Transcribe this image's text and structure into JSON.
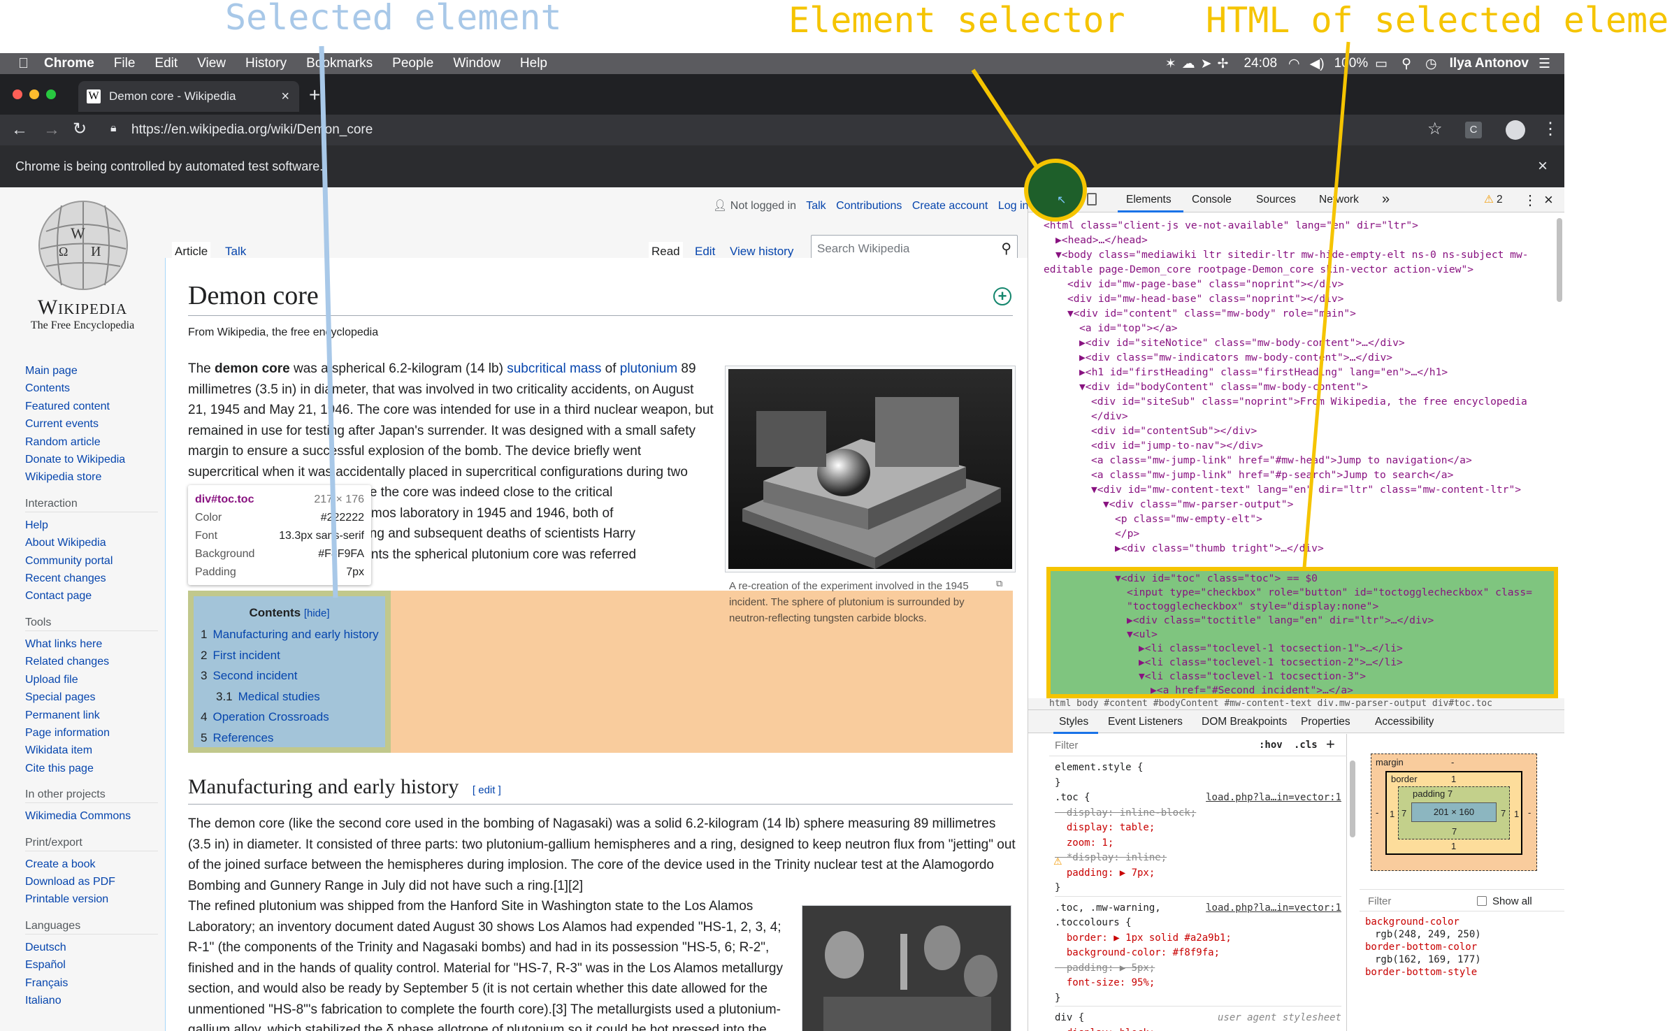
{
  "annotations": {
    "selected": "Selected element",
    "selector": "Element selector",
    "html": "HTML of selected element",
    "selected_color": "#a8c8e8",
    "selector_color": "#f5c400",
    "html_color": "#f5c400"
  },
  "menubar": {
    "app": "Chrome",
    "items": [
      "File",
      "Edit",
      "View",
      "History",
      "Bookmarks",
      "People",
      "Window",
      "Help"
    ],
    "time": "24:08",
    "battery": "100%",
    "user": "Ilya Antonov"
  },
  "tab": {
    "title": "Demon core - Wikipedia",
    "close": "×",
    "new": "+"
  },
  "toolbar": {
    "url": "https://en.wikipedia.org/wiki/Demon_core"
  },
  "infobar": {
    "text": "Chrome is being controlled by automated test software.",
    "close": "×"
  },
  "wiki": {
    "logo_title": "Wikipedia",
    "logo_sub": "The Free Encyclopedia",
    "personal": [
      "Not logged in",
      "Talk",
      "Contributions",
      "Create account",
      "Log in"
    ],
    "tabs_left": [
      "Article",
      "Talk"
    ],
    "tabs_right": [
      "Read",
      "Edit",
      "View history"
    ],
    "search_placeholder": "Search Wikipedia",
    "title": "Demon core",
    "from": "From Wikipedia, the free encyclopedia",
    "nav_main": [
      "Main page",
      "Contents",
      "Featured content",
      "Current events",
      "Random article",
      "Donate to Wikipedia",
      "Wikipedia store"
    ],
    "interaction_h": "Interaction",
    "interaction": [
      "Help",
      "About Wikipedia",
      "Community portal",
      "Recent changes",
      "Contact page"
    ],
    "tools_h": "Tools",
    "tools": [
      "What links here",
      "Related changes",
      "Upload file",
      "Special pages",
      "Permanent link",
      "Page information",
      "Wikidata item",
      "Cite this page"
    ],
    "projects_h": "In other projects",
    "projects": [
      "Wikimedia Commons"
    ],
    "print_h": "Print/export",
    "print": [
      "Create a book",
      "Download as PDF",
      "Printable version"
    ],
    "lang_h": "Languages",
    "langs": [
      "Deutsch",
      "Español",
      "Français",
      "Italiano"
    ],
    "para1": [
      [
        "The ",
        "demon core",
        " was a spherical 6.2-kilogram (14 lb) ",
        "subcritical mass",
        " of ",
        "plutonium",
        " 89"
      ],
      "millimetres (3.5 in) in diameter, that was involved in two criticality accidents, on August",
      "21, 1945 and May 21, 1946. The core was intended for use in a third nuclear weapon, but",
      "remained in use for testing after Japan's surrender. It was designed with a small safety",
      "margin to ensure a successful explosion of the bomb. The device briefly went",
      "supercritical when it was accidentally placed in supercritical configurations during two",
      "                    ended to guarantee the core was indeed close to the critical",
      "                    ined at the Los Alamos laboratory in 1945 and 1946, both of",
      "                    e radiation poisoning and subsequent deaths of scientists Harry",
      "                    . After these incidents the spherical plutonium core was referred"
    ],
    "figure_caption": "A re-creation of the experiment involved in the 1945 incident. The sphere of plutonium is surrounded by neutron-reflecting tungsten carbide blocks.",
    "tooltip": {
      "sel": "div#toc.toc",
      "size": "217 × 176",
      "rows": [
        [
          "Color",
          "#222222"
        ],
        [
          "Font",
          "13.3px sans-serif"
        ],
        [
          "Background",
          "#F8F9FA"
        ],
        [
          "Padding",
          "7px"
        ]
      ]
    },
    "toc": {
      "title": "Contents",
      "hide": "[hide]",
      "items": [
        [
          "1",
          "Manufacturing and early history"
        ],
        [
          "2",
          "First incident"
        ],
        [
          "3",
          "Second incident"
        ],
        [
          "3.1",
          "Medical studies"
        ],
        [
          "4",
          "Operation Crossroads"
        ],
        [
          "5",
          "References"
        ]
      ]
    },
    "h2": "Manufacturing and early history",
    "edit": "[ edit ]",
    "para2": [
      "The demon core (like the second core used in the bombing of Nagasaki) was a solid 6.2-kilogram (14 lb) sphere measuring 89 millimetres",
      "(3.5 in) in diameter. It consisted of three parts: two plutonium-gallium hemispheres and a ring, designed to keep neutron flux from \"jetting\" out",
      "of the joined surface between the hemispheres during implosion. The core of the device used in the Trinity nuclear test at the Alamogordo",
      "Bombing and Gunnery Range in July did not have such a ring.[1][2]"
    ],
    "para3": [
      "The refined plutonium was shipped from the Hanford Site in Washington state to the Los Alamos",
      "Laboratory; an inventory document dated August 30 shows Los Alamos had expended \"HS-1, 2, 3, 4;",
      "R-1\" (the components of the Trinity and Nagasaki bombs) and had in its possession \"HS-5, 6; R-2\",",
      "finished and in the hands of quality control. Material for \"HS-7, R-3\" was in the Los Alamos metallurgy",
      "section, and would also be ready by September 5 (it is not certain whether this date allowed for the",
      "unmentioned \"HS-8\"'s fabrication to complete the fourth core).[3] The metallurgists used a plutonium-",
      "gallium alloy, which stabilized the δ phase allotrope of plutonium so it could be hot pressed into the"
    ]
  },
  "devtools": {
    "tabs": [
      "Elements",
      "Console",
      "Sources",
      "Network",
      "»"
    ],
    "warn": "2",
    "dom": [
      {
        "i": 0,
        "t": "<html class=\"client-js ve-not-available\" lang=\"en\" dir=\"ltr\">"
      },
      {
        "i": 1,
        "t": "▶<head>…</head>"
      },
      {
        "i": 1,
        "t": "▼<body class=\"mediawiki ltr sitedir-ltr mw-hide-empty-elt ns-0 ns-subject mw-"
      },
      {
        "i": 0,
        "t": "editable page-Demon_core rootpage-Demon_core skin-vector action-view\">"
      },
      {
        "i": 2,
        "t": "<div id=\"mw-page-base\" class=\"noprint\"></div>"
      },
      {
        "i": 2,
        "t": "<div id=\"mw-head-base\" class=\"noprint\"></div>"
      },
      {
        "i": 2,
        "t": "▼<div id=\"content\" class=\"mw-body\" role=\"main\">"
      },
      {
        "i": 3,
        "t": "<a id=\"top\"></a>"
      },
      {
        "i": 3,
        "t": "▶<div id=\"siteNotice\" class=\"mw-body-content\">…</div>"
      },
      {
        "i": 3,
        "t": "▶<div class=\"mw-indicators mw-body-content\">…</div>"
      },
      {
        "i": 3,
        "t": "▶<h1 id=\"firstHeading\" class=\"firstHeading\" lang=\"en\">…</h1>"
      },
      {
        "i": 3,
        "t": "▼<div id=\"bodyContent\" class=\"mw-body-content\">"
      },
      {
        "i": 4,
        "t": "<div id=\"siteSub\" class=\"noprint\">From Wikipedia, the free encyclopedia"
      },
      {
        "i": 4,
        "t": "</div>"
      },
      {
        "i": 4,
        "t": "<div id=\"contentSub\"></div>"
      },
      {
        "i": 4,
        "t": "<div id=\"jump-to-nav\"></div>"
      },
      {
        "i": 4,
        "t": "<a class=\"mw-jump-link\" href=\"#mw-head\">Jump to navigation</a>"
      },
      {
        "i": 4,
        "t": "<a class=\"mw-jump-link\" href=\"#p-search\">Jump to search</a>"
      },
      {
        "i": 4,
        "t": "▼<div id=\"mw-content-text\" lang=\"en\" dir=\"ltr\" class=\"mw-content-ltr\">"
      },
      {
        "i": 5,
        "t": "▼<div class=\"mw-parser-output\">"
      },
      {
        "i": 6,
        "t": "<p class=\"mw-empty-elt\">"
      },
      {
        "i": 6,
        "t": "</p>"
      },
      {
        "i": 6,
        "t": "▶<div class=\"thumb tright\">…</div>"
      }
    ],
    "dom_sel": [
      {
        "i": 6,
        "t": "▼<div id=\"toc\" class=\"toc\"> == $0"
      },
      {
        "i": 7,
        "t": "<input type=\"checkbox\" role=\"button\" id=\"toctogglecheckbox\" class="
      },
      {
        "i": 7,
        "t": "\"toctogglecheckbox\" style=\"display:none\">"
      },
      {
        "i": 7,
        "t": "▶<div class=\"toctitle\" lang=\"en\" dir=\"ltr\">…</div>"
      },
      {
        "i": 7,
        "t": "▼<ul>"
      },
      {
        "i": 8,
        "t": "▶<li class=\"toclevel-1 tocsection-1\">…</li>"
      },
      {
        "i": 8,
        "t": "▶<li class=\"toclevel-1 tocsection-2\">…</li>"
      },
      {
        "i": 8,
        "t": "▼<li class=\"toclevel-1 tocsection-3\">"
      },
      {
        "i": 9,
        "t": "▶<a href=\"#Second_incident\">…</a>"
      }
    ],
    "breadcrumb": "html  body  #content  #bodyContent  #mw-content-text  div.mw-parser-output  div#toc.toc",
    "subtabs": [
      "Styles",
      "Event Listeners",
      "DOM Breakpoints",
      "Properties",
      "Accessibility"
    ],
    "filter": "Filter",
    "hov": ":hov",
    "cls": ".cls",
    "styles": [
      [
        "element.style {",
        ""
      ],
      [
        "}",
        ""
      ],
      [
        ".toc {",
        "load.php?la…in=vector:1"
      ],
      [
        "  display: inline-block;",
        ""
      ],
      [
        "  display: table;",
        ""
      ],
      [
        "  zoom: 1;",
        ""
      ],
      [
        "  *display: inline;",
        ""
      ],
      [
        "  padding: ▶ 7px;",
        ""
      ],
      [
        "}",
        ""
      ],
      [
        ".toc, .mw-warning,",
        "load.php?la…in=vector:1"
      ],
      [
        ".toccolours {",
        ""
      ],
      [
        "  border: ▶ 1px solid #a2a9b1;",
        ""
      ],
      [
        "  background-color: #f8f9fa;",
        ""
      ],
      [
        "  padding: ▶ 5px;",
        ""
      ],
      [
        "  font-size: 95%;",
        ""
      ],
      [
        "}",
        ""
      ],
      [
        "div {",
        "user agent stylesheet"
      ],
      [
        "  display: block;",
        ""
      ]
    ],
    "box": {
      "margin": "margin",
      "border": "border",
      "padding": "padding 7",
      "content": "201 × 160",
      "m": "-",
      "b": "1",
      "p": "7"
    },
    "computed_filter": "Filter",
    "show_all": "Show all",
    "computed": [
      [
        "background-color",
        "rgb(248, 249, 250)"
      ],
      [
        "border-bottom-color",
        "rgb(162, 169, 177)"
      ],
      [
        "border-bottom-style",
        ""
      ]
    ]
  }
}
